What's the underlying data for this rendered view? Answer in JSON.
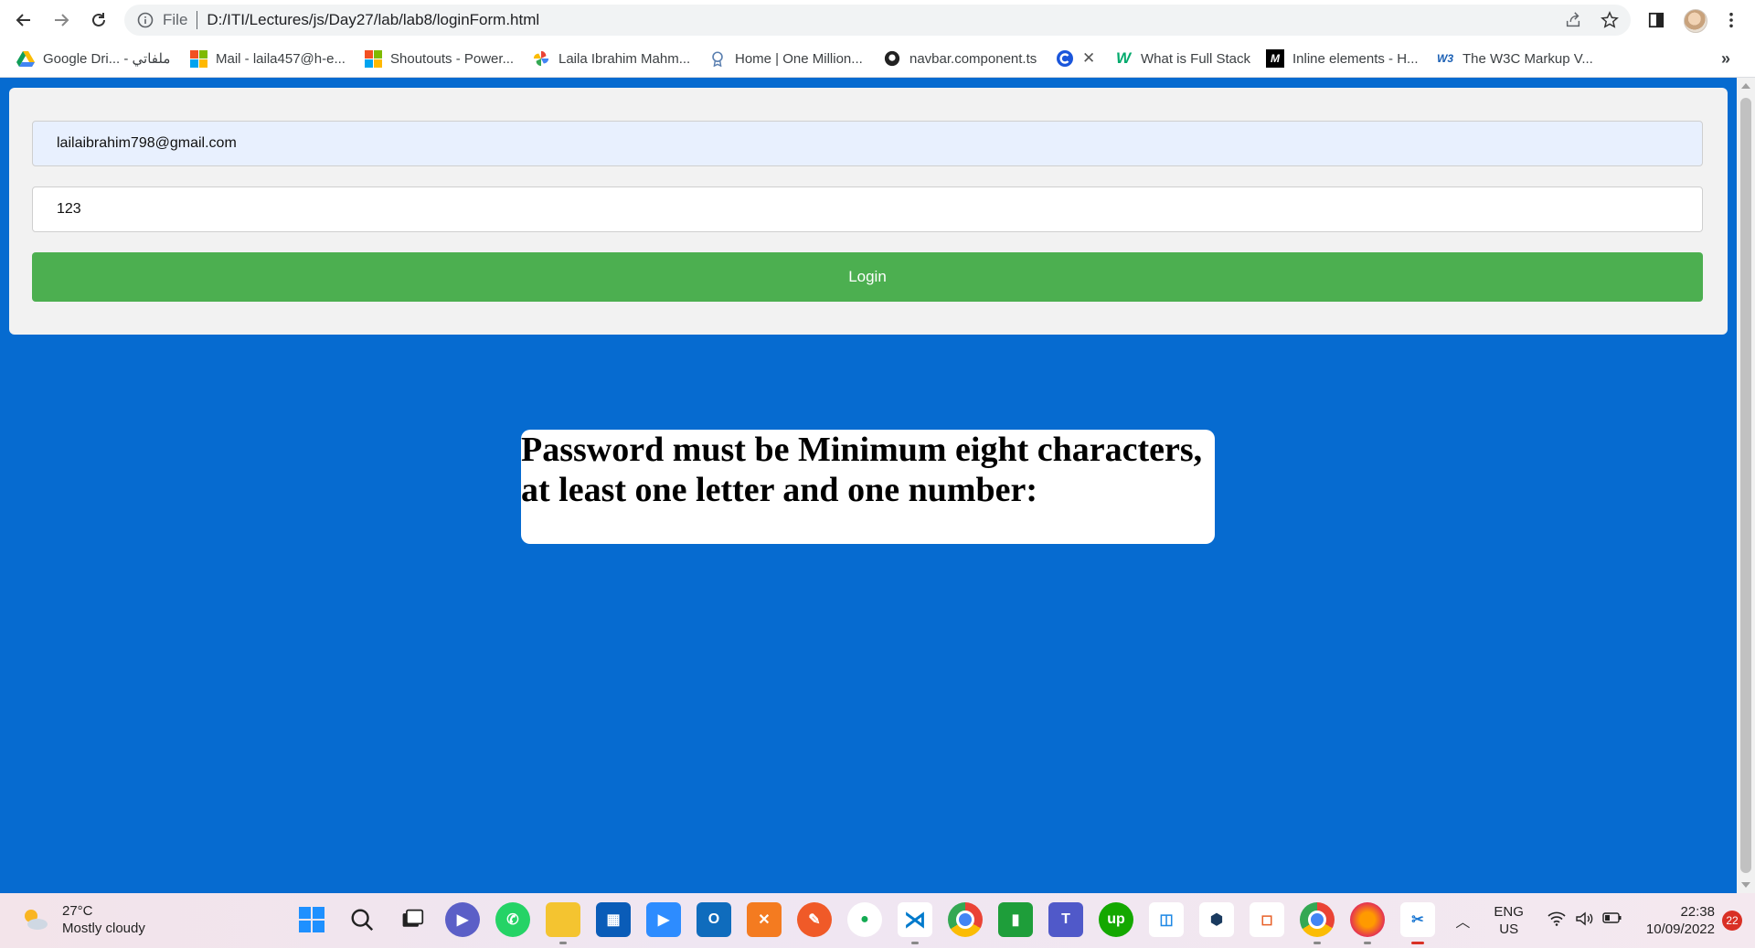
{
  "browser": {
    "file_label": "File",
    "url": "D:/ITI/Lectures/js/Day27/lab/lab8/loginForm.html"
  },
  "bookmarks": [
    {
      "label": "Google Dri... - ملفاتي",
      "icon": "google-drive-icon"
    },
    {
      "label": "Mail - laila457@h-e...",
      "icon": "microsoft-icon"
    },
    {
      "label": "Shoutouts - Power...",
      "icon": "microsoft-icon"
    },
    {
      "label": "Laila Ibrahim Mahm...",
      "icon": "pinwheel-icon"
    },
    {
      "label": "Home | One Million...",
      "icon": "award-icon"
    },
    {
      "label": "navbar.component.ts",
      "icon": "github-icon"
    },
    {
      "label": "",
      "icon": "c-logo-icon"
    },
    {
      "label": "What is Full Stack",
      "icon": "w3-logo-icon"
    },
    {
      "label": "Inline elements - H...",
      "icon": "mdn-icon"
    },
    {
      "label": "The W3C Markup V...",
      "icon": "w3c-icon"
    }
  ],
  "form": {
    "email_value": "lailaibrahim798@gmail.com",
    "password_value": "123",
    "login_label": "Login"
  },
  "message": {
    "text": "Password must be Minimum eight characters, at least one letter and one number:"
  },
  "taskbar": {
    "weather_temp": "27°C",
    "weather_desc": "Mostly cloudy",
    "lang_line1": "ENG",
    "lang_line2": "US",
    "time": "22:38",
    "date": "10/09/2022",
    "notification_count": "22"
  },
  "colors": {
    "page_background": "#066bd0",
    "login_button": "#4caf50",
    "autofill_field": "#e8f0fe"
  }
}
